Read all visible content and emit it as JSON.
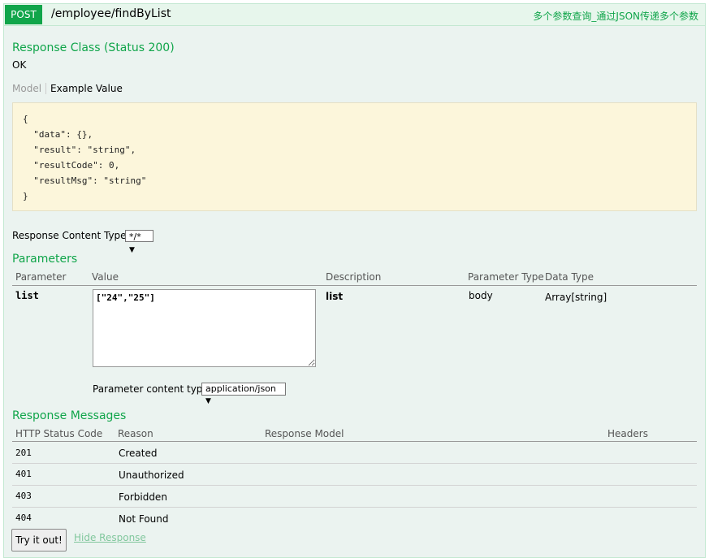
{
  "operation": {
    "method": "POST",
    "path": "/employee/findByList",
    "summary": "多个参数查询_通过JSON传递多个参数"
  },
  "response_class": {
    "title": "Response Class (Status 200)",
    "status_text": "OK",
    "tabs": {
      "model": "Model",
      "example": "Example Value"
    },
    "example_lines": [
      "{",
      "  \"data\": {},",
      "  \"result\": \"string\",",
      "  \"resultCode\": 0,",
      "  \"resultMsg\": \"string\"",
      "}"
    ]
  },
  "response_content_type": {
    "label": "Response Content Type",
    "value": "*/*"
  },
  "parameters": {
    "title": "Parameters",
    "headers": [
      "Parameter",
      "Value",
      "Description",
      "Parameter Type",
      "Data Type"
    ],
    "rows": [
      {
        "parameter": "list",
        "value": "[\"24\",\"25\"]",
        "description": "list",
        "parameter_type": "body",
        "data_type": "Array[string]"
      }
    ],
    "content_type_label": "Parameter content type:",
    "content_type_value": "application/json"
  },
  "response_messages": {
    "title": "Response Messages",
    "headers": [
      "HTTP Status Code",
      "Reason",
      "Response Model",
      "Headers"
    ],
    "rows": [
      {
        "code": "201",
        "reason": "Created"
      },
      {
        "code": "401",
        "reason": "Unauthorized"
      },
      {
        "code": "403",
        "reason": "Forbidden"
      },
      {
        "code": "404",
        "reason": "Not Found"
      }
    ]
  },
  "actions": {
    "try_button": "Try it out!",
    "hide_link": "Hide Response"
  },
  "colors": {
    "accent_green": "#10a54a",
    "panel_bg": "#ebf3f0",
    "example_bg": "#fcf6db"
  }
}
